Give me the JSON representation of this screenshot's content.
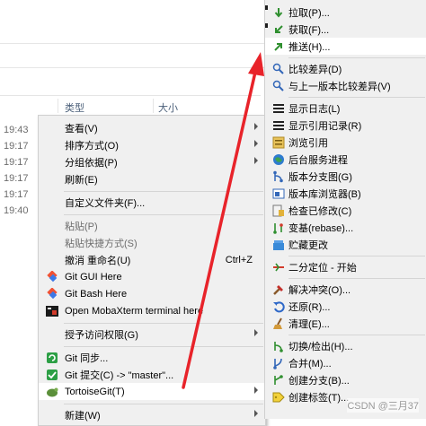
{
  "explorer": {
    "columns": {
      "type": "类型",
      "size": "大小"
    },
    "times": [
      "19:43",
      "19:17",
      "19:17",
      "19:17",
      "19:17",
      "19:40"
    ]
  },
  "context_menu": {
    "items": [
      {
        "label": "查看(V)",
        "submenu": true
      },
      {
        "label": "排序方式(O)",
        "submenu": true
      },
      {
        "label": "分组依据(P)",
        "submenu": true
      },
      {
        "label": "刷新(E)"
      },
      {
        "label": "自定义文件夹(F)..."
      },
      {
        "label": "粘贴(P)",
        "disabled": true
      },
      {
        "label": "粘贴快捷方式(S)",
        "disabled": true
      },
      {
        "label": "撤消 重命名(U)",
        "shortcut": "Ctrl+Z"
      },
      {
        "label": "Git GUI Here"
      },
      {
        "label": "Git Bash Here"
      },
      {
        "label": "Open MobaXterm terminal here"
      },
      {
        "label": "授予访问权限(G)",
        "submenu": true
      },
      {
        "label": "Git 同步..."
      },
      {
        "label": "Git 提交(C) -> \"master\"..."
      },
      {
        "label": "TortoiseGit(T)",
        "submenu": true
      },
      {
        "label": "新建(W)",
        "submenu": true
      }
    ]
  },
  "submenu": {
    "items": [
      {
        "label": "拉取(P)...",
        "icon": "pull-icon"
      },
      {
        "label": "获取(F)...",
        "icon": "fetch-icon"
      },
      {
        "label": "推送(H)...",
        "icon": "push-icon"
      },
      {
        "label": "比较差异(D)",
        "icon": "diff-icon"
      },
      {
        "label": "与上一版本比较差异(V)",
        "icon": "diff-prev-icon"
      },
      {
        "label": "显示日志(L)",
        "icon": "log-icon"
      },
      {
        "label": "显示引用记录(R)",
        "icon": "reflog-icon"
      },
      {
        "label": "浏览引用",
        "icon": "browse-refs-icon"
      },
      {
        "label": "后台服务进程",
        "icon": "daemon-icon"
      },
      {
        "label": "版本分支图(G)",
        "icon": "revision-graph-icon"
      },
      {
        "label": "版本库浏览器(B)",
        "icon": "repo-browser-icon"
      },
      {
        "label": "检查已修改(C)",
        "icon": "check-modifications-icon"
      },
      {
        "label": "变基(rebase)...",
        "icon": "rebase-icon"
      },
      {
        "label": "贮藏更改",
        "icon": "stash-icon"
      },
      {
        "label": "二分定位 - 开始",
        "icon": "bisect-icon"
      },
      {
        "label": "解决冲突(O)...",
        "icon": "resolve-icon"
      },
      {
        "label": "还原(R)...",
        "icon": "revert-icon"
      },
      {
        "label": "清理(E)...",
        "icon": "cleanup-icon"
      },
      {
        "label": "切换/检出(H)...",
        "icon": "switch-icon"
      },
      {
        "label": "合并(M)...",
        "icon": "merge-icon"
      },
      {
        "label": "创建分支(B)...",
        "icon": "branch-icon"
      },
      {
        "label": "创建标签(T)...",
        "icon": "tag-icon"
      }
    ]
  },
  "watermark": "CSDN @三月37",
  "colors": {
    "arrow": "#e8232a",
    "menu_bg": "#f0f0f0",
    "highlight": "#ffffff"
  }
}
